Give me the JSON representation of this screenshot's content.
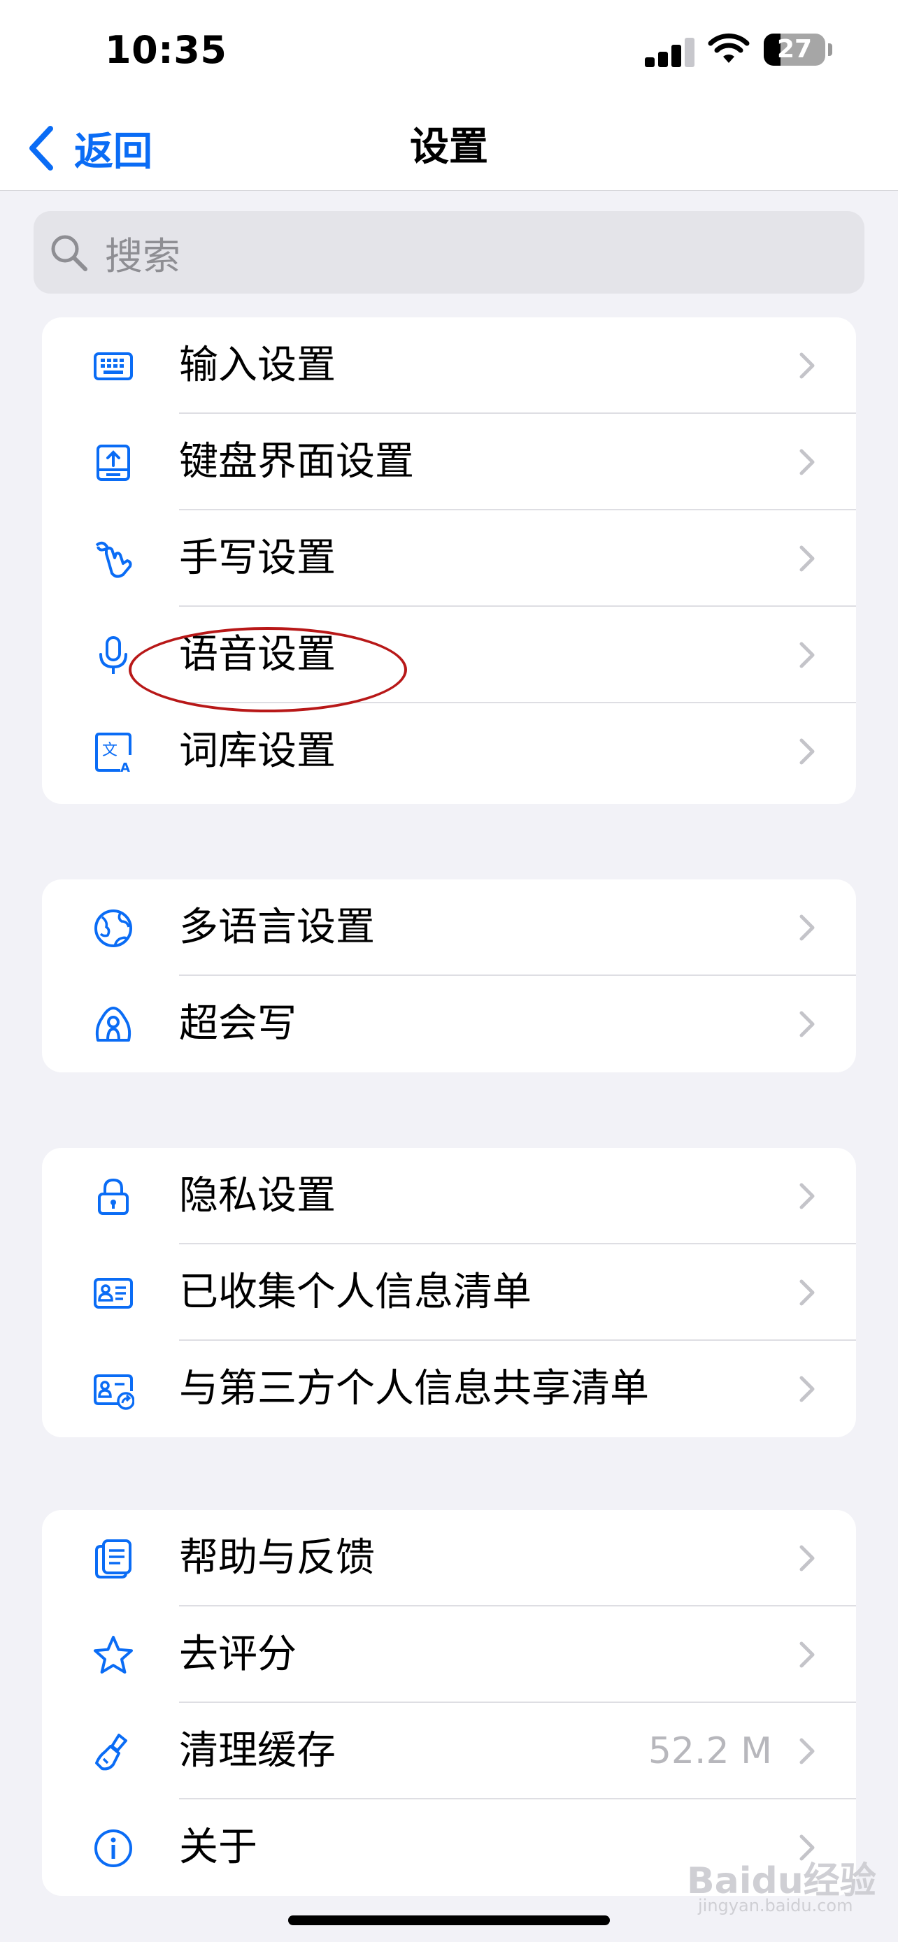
{
  "status_bar": {
    "time": "10:35",
    "battery_level": "27"
  },
  "nav": {
    "back_label": "返回",
    "title": "设置"
  },
  "search": {
    "placeholder": "搜索"
  },
  "groups": [
    {
      "items": [
        {
          "icon": "keyboard-icon",
          "label": "输入设置"
        },
        {
          "icon": "keyboard-layout-icon",
          "label": "键盘界面设置"
        },
        {
          "icon": "handwriting-icon",
          "label": "手写设置"
        },
        {
          "icon": "microphone-icon",
          "label": "语音设置"
        },
        {
          "icon": "dictionary-icon",
          "label": "词库设置"
        }
      ]
    },
    {
      "items": [
        {
          "icon": "globe-icon",
          "label": "多语言设置"
        },
        {
          "icon": "super-write-icon",
          "label": "超会写"
        }
      ]
    },
    {
      "items": [
        {
          "icon": "lock-icon",
          "label": "隐私设置"
        },
        {
          "icon": "id-card-icon",
          "label": "已收集个人信息清单"
        },
        {
          "icon": "id-card-share-icon",
          "label": "与第三方个人信息共享清单"
        }
      ]
    },
    {
      "items": [
        {
          "icon": "help-document-icon",
          "label": "帮助与反馈"
        },
        {
          "icon": "star-icon",
          "label": "去评分"
        },
        {
          "icon": "brush-icon",
          "label": "清理缓存",
          "value": "52.2 M"
        },
        {
          "icon": "info-icon",
          "label": "关于"
        }
      ]
    }
  ],
  "colors": {
    "accent": "#0a6cf5",
    "highlight_ring": "#b81818"
  },
  "watermark": {
    "text": "Baidu经验",
    "sub": "jingyan.baidu.com"
  }
}
